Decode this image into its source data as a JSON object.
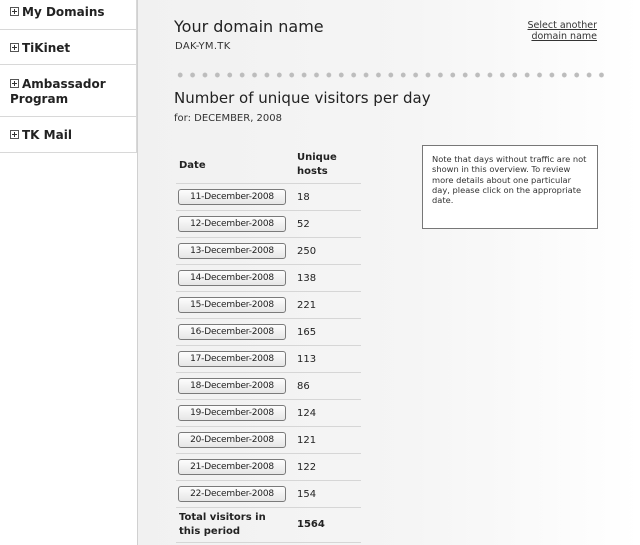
{
  "sidebar": {
    "items": [
      {
        "label": "My Domains"
      },
      {
        "label": "TiKinet"
      },
      {
        "label_line1": "Ambassador",
        "label_line2": "Program"
      },
      {
        "label": "TK Mail"
      }
    ]
  },
  "header": {
    "title": "Your domain name",
    "domain": "DAK-YM.TK",
    "select_link_line1": "Select another",
    "select_link_line2": "domain name"
  },
  "section": {
    "title": "Number of unique visitors per day",
    "subtitle": "for: DECEMBER, 2008"
  },
  "table": {
    "headers": {
      "date": "Date",
      "hosts_line1": "Unique",
      "hosts_line2": "hosts"
    },
    "rows": [
      {
        "date": "11-December-2008",
        "hosts": "18"
      },
      {
        "date": "12-December-2008",
        "hosts": "52"
      },
      {
        "date": "13-December-2008",
        "hosts": "250"
      },
      {
        "date": "14-December-2008",
        "hosts": "138"
      },
      {
        "date": "15-December-2008",
        "hosts": "221"
      },
      {
        "date": "16-December-2008",
        "hosts": "165"
      },
      {
        "date": "17-December-2008",
        "hosts": "113"
      },
      {
        "date": "18-December-2008",
        "hosts": "86"
      },
      {
        "date": "19-December-2008",
        "hosts": "124"
      },
      {
        "date": "20-December-2008",
        "hosts": "121"
      },
      {
        "date": "21-December-2008",
        "hosts": "122"
      },
      {
        "date": "22-December-2008",
        "hosts": "154"
      }
    ],
    "total_label_line1": "Total visitors in",
    "total_label_line2": "this period",
    "total_value": "1564"
  },
  "note": {
    "text": "Note that days without traffic are not shown in this overview. To review more details about one particular day, please click on the appropriate date."
  },
  "icons": {
    "expand": "plus-box-icon"
  }
}
